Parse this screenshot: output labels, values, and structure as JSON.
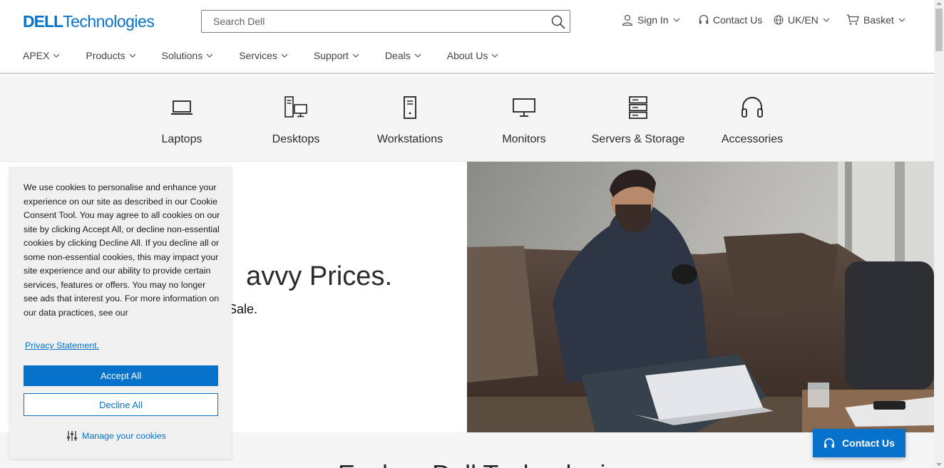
{
  "brand": {
    "logo_bold": "DELL",
    "logo_rest": "Technologies",
    "color": "#0672cb"
  },
  "search": {
    "placeholder": "Search Dell"
  },
  "utility": {
    "sign_in": "Sign In",
    "contact": "Contact Us",
    "locale": "UK/EN",
    "basket": "Basket"
  },
  "nav": {
    "items": [
      "APEX",
      "Products",
      "Solutions",
      "Services",
      "Support",
      "Deals",
      "About Us"
    ]
  },
  "categories": [
    "Laptops",
    "Desktops",
    "Workstations",
    "Monitors",
    "Servers & Storage",
    "Accessories"
  ],
  "hero": {
    "heading": "avvy Prices.",
    "subheading": "Sale."
  },
  "cookie": {
    "text": "We use cookies to personalise and enhance your experience on our site as described in our Cookie Consent Tool. You may agree to all cookies on our site by clicking Accept All, or decline non-essential cookies by clicking Decline All. If you decline all or some non-essential cookies, this may impact your site experience and our ability to provide certain services, features or offers. You may no longer see ads that interest you. For more information on our data practices, see our",
    "privacy_link": "Privacy Statement.",
    "accept": "Accept All",
    "decline": "Decline All",
    "manage": "Manage your cookies"
  },
  "below": {
    "title": "Explore Dell Technologies"
  },
  "contact_fab": {
    "label": "Contact Us"
  }
}
